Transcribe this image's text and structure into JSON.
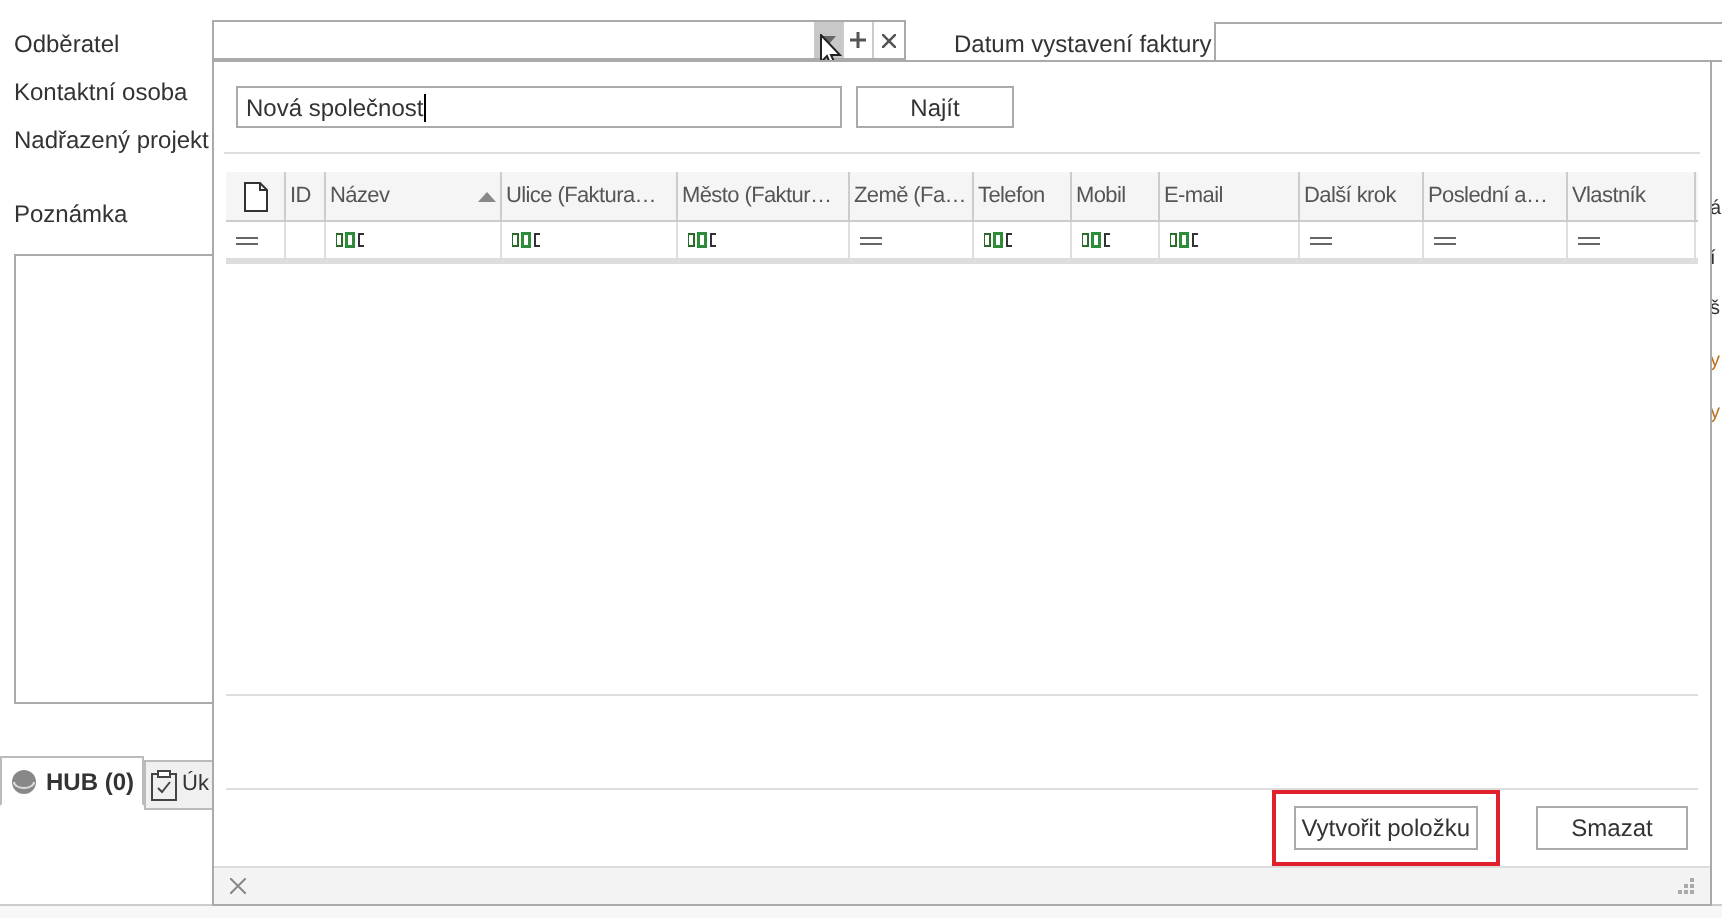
{
  "form": {
    "labels": [
      "Odběratel",
      "Kontaktní osoba",
      "Nadřazený projekt",
      "Poznámka"
    ],
    "invoice_date_label": "Datum vystavení faktury",
    "right_fragments": [
      "á",
      "í",
      "š",
      "y",
      "y"
    ]
  },
  "tabs": [
    {
      "label": "HUB (0)",
      "selected": true,
      "kind": "hub"
    },
    {
      "label": "Úk",
      "selected": false,
      "kind": "task"
    }
  ],
  "popup": {
    "search_value": "Nová společnost",
    "search_button": "Najít",
    "columns": [
      {
        "kind": "doc",
        "sorted": false
      },
      {
        "label": "ID",
        "sorted": false
      },
      {
        "label": "Název",
        "sorted": true
      },
      {
        "label": "Ulice (Faktura…",
        "sorted": false
      },
      {
        "label": "Město (Faktur…",
        "sorted": false
      },
      {
        "label": "Země (Fa…",
        "sorted": false
      },
      {
        "label": "Telefon",
        "sorted": false
      },
      {
        "label": "Mobil",
        "sorted": false
      },
      {
        "label": "E-mail",
        "sorted": false
      },
      {
        "label": "Další krok",
        "sorted": false
      },
      {
        "label": "Poslední a…",
        "sorted": false
      },
      {
        "label": "Vlastník",
        "sorted": false
      }
    ],
    "filter_row": [
      {
        "kind": "equals"
      },
      {
        "kind": "none"
      },
      {
        "kind": "text"
      },
      {
        "kind": "text"
      },
      {
        "kind": "text"
      },
      {
        "kind": "equals"
      },
      {
        "kind": "text"
      },
      {
        "kind": "text"
      },
      {
        "kind": "text"
      },
      {
        "kind": "equals"
      },
      {
        "kind": "equals"
      },
      {
        "kind": "equals"
      }
    ],
    "buttons": [
      {
        "label": "Vytvořit položku",
        "highlighted": true
      },
      {
        "label": "Smazat",
        "highlighted": false
      }
    ]
  }
}
